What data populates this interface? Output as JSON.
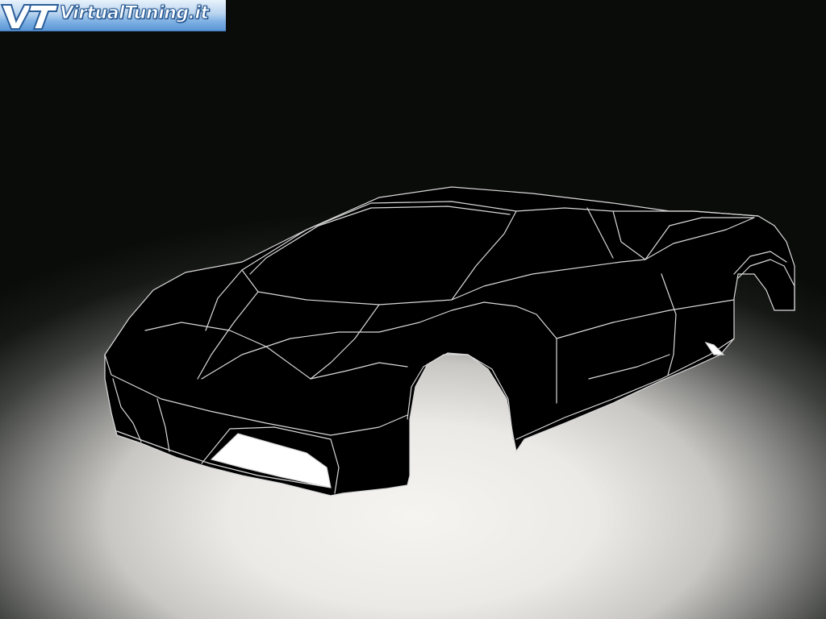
{
  "logo": {
    "mark": "VT",
    "site": "VirtualTuning.it"
  },
  "colors": {
    "background_center": "#eceae6",
    "background_edge": "#0a0c09",
    "car_body": "#000000",
    "car_lines": "#d9d9d9",
    "logo_blue": "#5a96d6"
  }
}
